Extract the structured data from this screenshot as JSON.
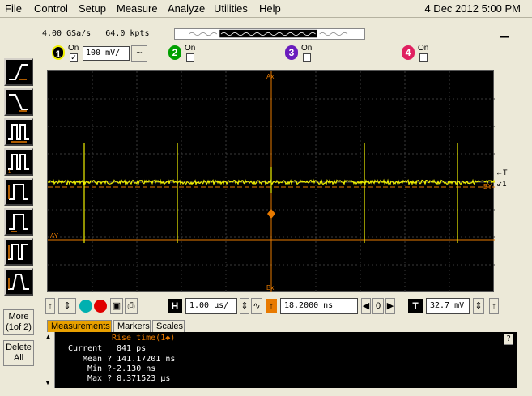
{
  "menu": {
    "items": [
      "File",
      "Control",
      "Setup",
      "Measure",
      "Analyze",
      "Utilities",
      "Help"
    ],
    "datetime": "4 Dec 2012  5:00 PM"
  },
  "acquisition": {
    "sample_rate": "4.00 GSa/s",
    "memory_depth": "64.0 kpts"
  },
  "channels": [
    {
      "number": "1",
      "label": "On",
      "checked": true,
      "scale": "100 mV/",
      "color": "#f0f000"
    },
    {
      "number": "2",
      "label": "On",
      "checked": false,
      "color": "#00a000"
    },
    {
      "number": "3",
      "label": "On",
      "checked": false,
      "color": "#6a1cbd"
    },
    {
      "number": "4",
      "label": "On",
      "checked": false,
      "color": "#e02060"
    }
  ],
  "side_buttons": {
    "more_line1": "More",
    "more_line2": "(1of 2)",
    "delete_line1": "Delete",
    "delete_line2": "All"
  },
  "screen": {
    "marker_ax": "Ax",
    "marker_bx": "Bx",
    "marker_ay": "AY",
    "marker_by": "BY",
    "trigger_label": "T",
    "channel_marker": "1",
    "trace_color": "#f0f000",
    "marker_color": "#e87a00"
  },
  "horizontal": {
    "badge": "H",
    "timebase": "1.00 µs/",
    "delay_badge": "↑",
    "delay": "18.2000 ns"
  },
  "trigger": {
    "badge": "T",
    "level": "32.7 mV"
  },
  "tabs": [
    "Measurements",
    "Markers",
    "Scales"
  ],
  "measurements": {
    "title": "Rise time(1◆)",
    "current_label": "Current",
    "current_value": "841 ps",
    "mean": "Mean ? 141.17201 ns",
    "min": "Min ?-2.130 ns",
    "max": "Max ? 8.371523 µs",
    "help": "?"
  }
}
